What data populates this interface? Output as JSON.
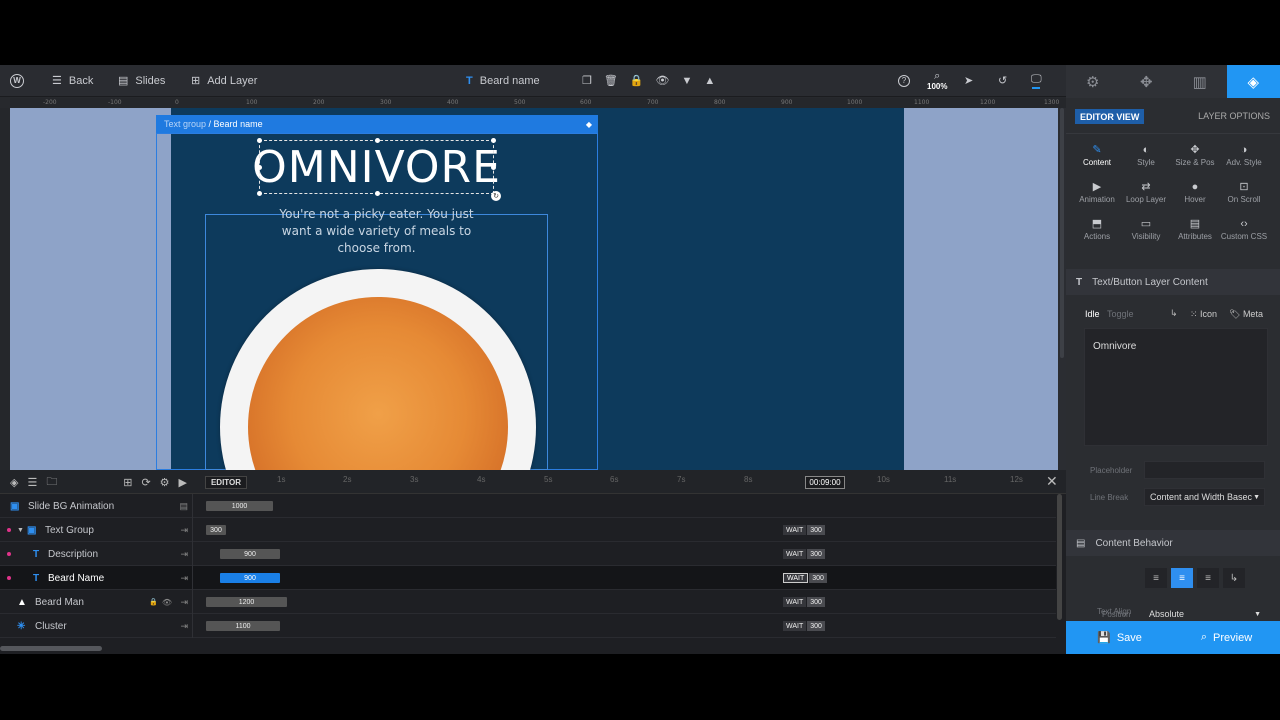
{
  "toolbar": {
    "back": "Back",
    "slides": "Slides",
    "add_layer": "Add Layer",
    "layer_name": "Beard name",
    "zoom": "100%"
  },
  "ruler": [
    "-200",
    "-100",
    "0",
    "100",
    "200",
    "300",
    "400",
    "500",
    "600",
    "700",
    "800",
    "900",
    "1000",
    "1100",
    "1200",
    "1300"
  ],
  "canvas": {
    "group_path": "Text group",
    "group_sep": " / ",
    "group_layer": "Beard name",
    "title": "OMNIVORE",
    "description": "You're not a picky eater. You just want a wide variety of meals to choose from."
  },
  "timeline": {
    "editor": "EDITOR",
    "seconds": [
      "1s",
      "2s",
      "3s",
      "4s",
      "5s",
      "6s",
      "7s",
      "8s",
      "10s",
      "11s",
      "12s"
    ],
    "current_time": "00:09:00",
    "rows": [
      {
        "label": "Slide BG Animation",
        "bar": "1000",
        "wait": "",
        "wait_val": ""
      },
      {
        "label": "Text Group",
        "bar": "300",
        "wait": "WAIT",
        "wait_val": "300"
      },
      {
        "label": "Description",
        "bar": "900",
        "wait": "WAIT",
        "wait_val": "300"
      },
      {
        "label": "Beard Name",
        "bar": "900",
        "wait": "WAIT",
        "wait_val": "300"
      },
      {
        "label": "Beard Man",
        "bar": "1200",
        "wait": "WAIT",
        "wait_val": "300"
      },
      {
        "label": "Cluster",
        "bar": "1100",
        "wait": "WAIT",
        "wait_val": "300"
      }
    ]
  },
  "panel": {
    "editor_view": "EDITOR VIEW",
    "layer_options": "LAYER OPTIONS",
    "options": [
      "Content",
      "Style",
      "Size & Pos",
      "Adv. Style",
      "Animation",
      "Loop Layer",
      "Hover",
      "On Scroll",
      "Actions",
      "Visibility",
      "Attributes",
      "Custom CSS"
    ],
    "section_content": "Text/Button Layer Content",
    "state_idle": "Idle",
    "state_toggle": "Toggle",
    "icon": "Icon",
    "meta": "Meta",
    "content_value": "Omnivore",
    "placeholder_label": "Placeholder",
    "line_break_label": "Line Break",
    "line_break_value": "Content and Width Basec",
    "section_behavior": "Content Behavior",
    "text_align_label": "Text Align",
    "position_label": "Position",
    "position_value": "Absolute",
    "save": "Save",
    "preview": "Preview"
  },
  "colors": {
    "accent": "#2196f3",
    "slide_bg": "#0d3a5c",
    "canvas_bg": "#8ea3c8",
    "marker": "#e0338a"
  }
}
